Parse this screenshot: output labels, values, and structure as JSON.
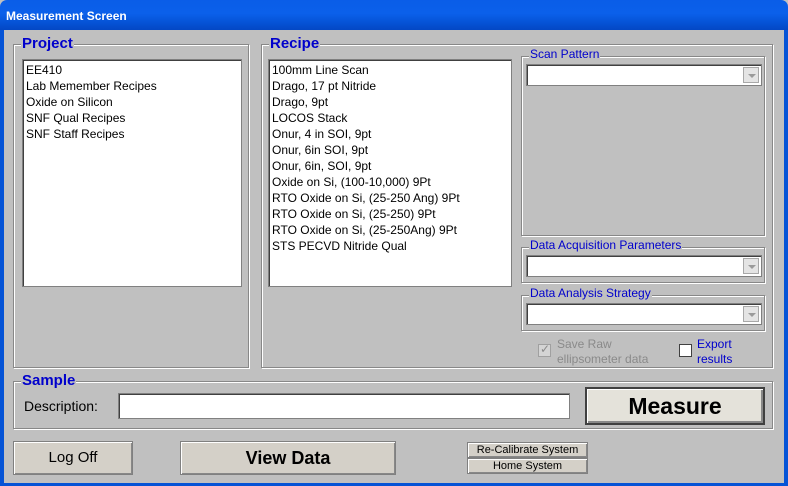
{
  "window": {
    "title": "Measurement Screen"
  },
  "project": {
    "title": "Project",
    "items": [
      "EE410",
      "Lab Memember Recipes",
      "Oxide on Silicon",
      "SNF Qual Recipes",
      "SNF Staff Recipes"
    ]
  },
  "recipe": {
    "title": "Recipe",
    "items": [
      "100mm Line Scan",
      "Drago, 17 pt Nitride",
      "Drago, 9pt",
      "LOCOS Stack",
      "Onur, 4 in SOI, 9pt",
      "Onur, 6in SOI, 9pt",
      "Onur, 6in, SOI, 9pt",
      "Oxide on Si, (100-10,000) 9Pt",
      "RTO Oxide on Si, (25-250 Ang) 9Pt",
      "RTO Oxide on Si, (25-250) 9Pt",
      "RTO Oxide on Si, (25-250Ang) 9Pt",
      "STS PECVD Nitride Qual"
    ]
  },
  "scan_pattern": {
    "title": "Scan Pattern",
    "value": ""
  },
  "data_acquisition": {
    "title": "Data Acquisition Parameters",
    "value": ""
  },
  "data_analysis": {
    "title": "Data Analysis Strategy",
    "value": ""
  },
  "options": {
    "save_raw": {
      "label_line1": "Save Raw",
      "label_line2": "ellipsometer data",
      "checked": true,
      "enabled": false
    },
    "export_results": {
      "label_line1": "Export",
      "label_line2": "results",
      "checked": false,
      "enabled": true
    }
  },
  "sample": {
    "title": "Sample",
    "description_label": "Description:",
    "description_value": ""
  },
  "buttons": {
    "measure": "Measure",
    "log_off": "Log Off",
    "view_data": "View Data",
    "recalibrate": "Re-Calibrate System",
    "home_system": "Home System"
  }
}
